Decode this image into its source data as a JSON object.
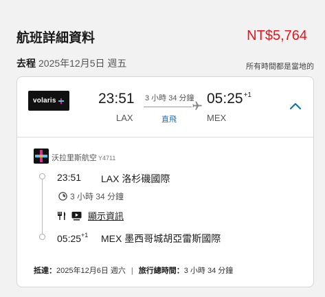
{
  "page_title": "航班詳細資料",
  "price": "NT$5,764",
  "leg": {
    "label": "去程",
    "date": "2025年12月5日 週五",
    "local_time_note": "所有時間都是當地的"
  },
  "summary": {
    "airline_logo_text": "volaris",
    "departure_time": "23:51",
    "departure_code": "LAX",
    "duration": "3 小時 34 分鐘",
    "stops": "直飛",
    "arrival_time": "05:25",
    "arrival_day_offset": "+1",
    "arrival_code": "MEX"
  },
  "detail": {
    "airline_name": "沃拉里斯航空",
    "flight_code": "Y4711",
    "departure_time": "23:51",
    "departure_airport": "LAX 洛杉磯國際",
    "duration": "3 小時 34 分鐘",
    "show_info_label": "顯示資訊",
    "arrival_time": "05:25",
    "arrival_day_offset": "+1",
    "arrival_airport": "MEX 墨西哥城胡亞雷斯國際"
  },
  "footer": {
    "arrival_label": "抵達：",
    "arrival_date": "2025年12月6日 週六",
    "total_label": "旅行總時間：",
    "total_duration": "3 小時 34 分鐘"
  },
  "icons": {
    "collapse": "chevron-up-icon",
    "plane": "plane-icon",
    "clock": "clock-icon",
    "meal": "fork-knife-icon",
    "entertainment": "screen-icon"
  },
  "colors": {
    "price": "#e8141b",
    "link_blue": "#1a6fad",
    "accent_blue": "#1a6fad"
  }
}
